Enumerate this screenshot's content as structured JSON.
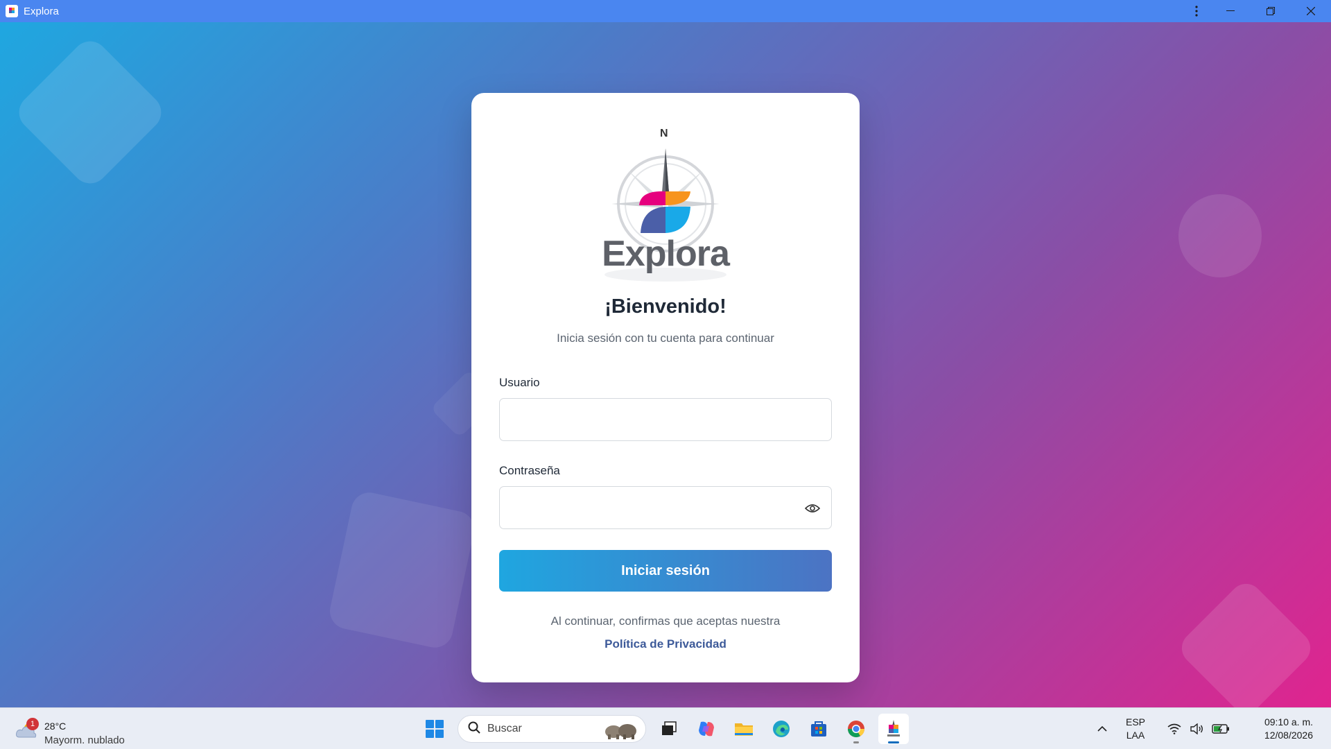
{
  "window": {
    "title": "Explora",
    "icon": "explora-app-icon"
  },
  "login": {
    "logo_text": "Explora",
    "logo_compass_letter": "N",
    "heading": "¡Bienvenido!",
    "subtitle": "Inicia sesión con tu cuenta para continuar",
    "username_label": "Usuario",
    "username_value": "",
    "password_label": "Contraseña",
    "password_value": "",
    "submit_label": "Iniciar sesión",
    "consent_text": "Al continuar, confirmas que aceptas nuestra",
    "privacy_link": "Política de Privacidad"
  },
  "colors": {
    "titlebar": "#4a86f0",
    "gradient_start": "#1fa7e0",
    "gradient_end": "#e0248f",
    "button_start": "#1fa6e0",
    "button_end": "#4c73c3",
    "link": "#3d5a99"
  },
  "taskbar": {
    "weather": {
      "badge": "1",
      "temperature": "28°C",
      "condition": "Mayorm. nublado"
    },
    "search_placeholder": "Buscar",
    "apps": [
      "windows-start-icon",
      "task-view-icon",
      "copilot-icon",
      "file-explorer-icon",
      "edge-icon",
      "microsoft-store-icon",
      "chrome-icon",
      "explora-app-icon"
    ],
    "language": {
      "line1": "ESP",
      "line2": "LAA"
    },
    "clock": {
      "time": "09:10 a. m.",
      "date": "12/08/2026"
    }
  }
}
